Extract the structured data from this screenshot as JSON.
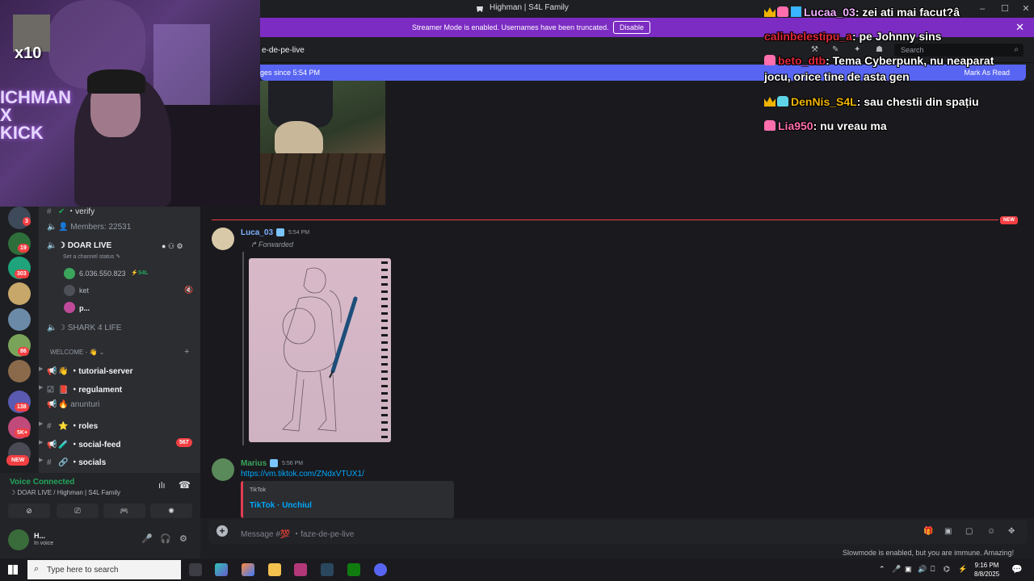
{
  "window": {
    "title": "Highman | S4L Family",
    "minimize": "–",
    "maximize": "☐",
    "close": "✕"
  },
  "banner": {
    "message": "Streamer Mode is enabled. Usernames have been truncated.",
    "disable_label": "Disable",
    "close": "✕"
  },
  "channel": {
    "name": "e-de-pe-live",
    "search_placeholder": "Search"
  },
  "newbar": {
    "left": "ges since 5:54 PM",
    "right": "Mark As Read"
  },
  "new_pill": "NEW",
  "messages": [
    {
      "user": "Luca_03",
      "time": "5:54 PM",
      "forwarded": "Forwarded",
      "user_color": "#7cb0ff"
    },
    {
      "user": "Marius",
      "time": "5:56 PM",
      "link": "https://vm.tiktok.com/ZNdxVTUX1/",
      "embed_provider": "TikTok",
      "embed_title": "TikTok · Unchiul",
      "user_color": "#3ba55c"
    }
  ],
  "composer": {
    "placeholder": "Message #💯 ・faze-de-pe-live"
  },
  "slowmode": "Slowmode is enabled, but you are immune. Amazing!",
  "rail": {
    "counts": [
      "3",
      "19",
      "303",
      "86",
      "138",
      "5K+"
    ],
    "new_label": "NEW"
  },
  "channels": [
    {
      "label": "・verify"
    },
    {
      "label": "Members: 22531"
    },
    {
      "label": "DOAR LIVE"
    },
    {
      "label": "Set a channel status"
    },
    {
      "label": "SHARK 4 LIFE"
    },
    {
      "label": "WELCOME - 👋"
    },
    {
      "label": "・tutorial-server"
    },
    {
      "label": "・regulament"
    },
    {
      "label": "anunturi"
    },
    {
      "label": "・roles"
    },
    {
      "label": "・social-feed"
    },
    {
      "label": "・socials"
    }
  ],
  "social_feed_count": "567",
  "voice_users": [
    {
      "name": "6.036.550.823",
      "tag": "S4L"
    },
    {
      "name": "ket"
    },
    {
      "name": "p..."
    }
  ],
  "voice_panel": {
    "status": "Voice Connected",
    "sub": "DOAR LIVE / Highman | S4L Family"
  },
  "user_panel": {
    "name": "H...",
    "status": "In voice"
  },
  "webcam": {
    "x10": "x10",
    "neon": "ICHMAN\nX\nKICK"
  },
  "overlay_chat": [
    {
      "user": "Lucaa_03",
      "text": "zei ati mai facut?â",
      "user_color": "#f0b0ff"
    },
    {
      "user": "calinbelestipu_a",
      "text": "pe Johnny sins",
      "user_color": "#e0283c"
    },
    {
      "user": "beto_dtb",
      "text": "Tema Cyberpunk, nu neaparat",
      "text2": "jocu, orice tine de asta gen",
      "user_color": "#e0283c"
    },
    {
      "user": "DenNis_S4L",
      "text": "sau chestii din spațiu",
      "user_color": "#f0b400"
    },
    {
      "user": "Lia950",
      "text": "nu vreau ma",
      "user_color": "#ff6fae"
    }
  ],
  "taskbar": {
    "search_placeholder": "Type here to search",
    "time": "9:16 PM",
    "date": "8/8/2025"
  }
}
